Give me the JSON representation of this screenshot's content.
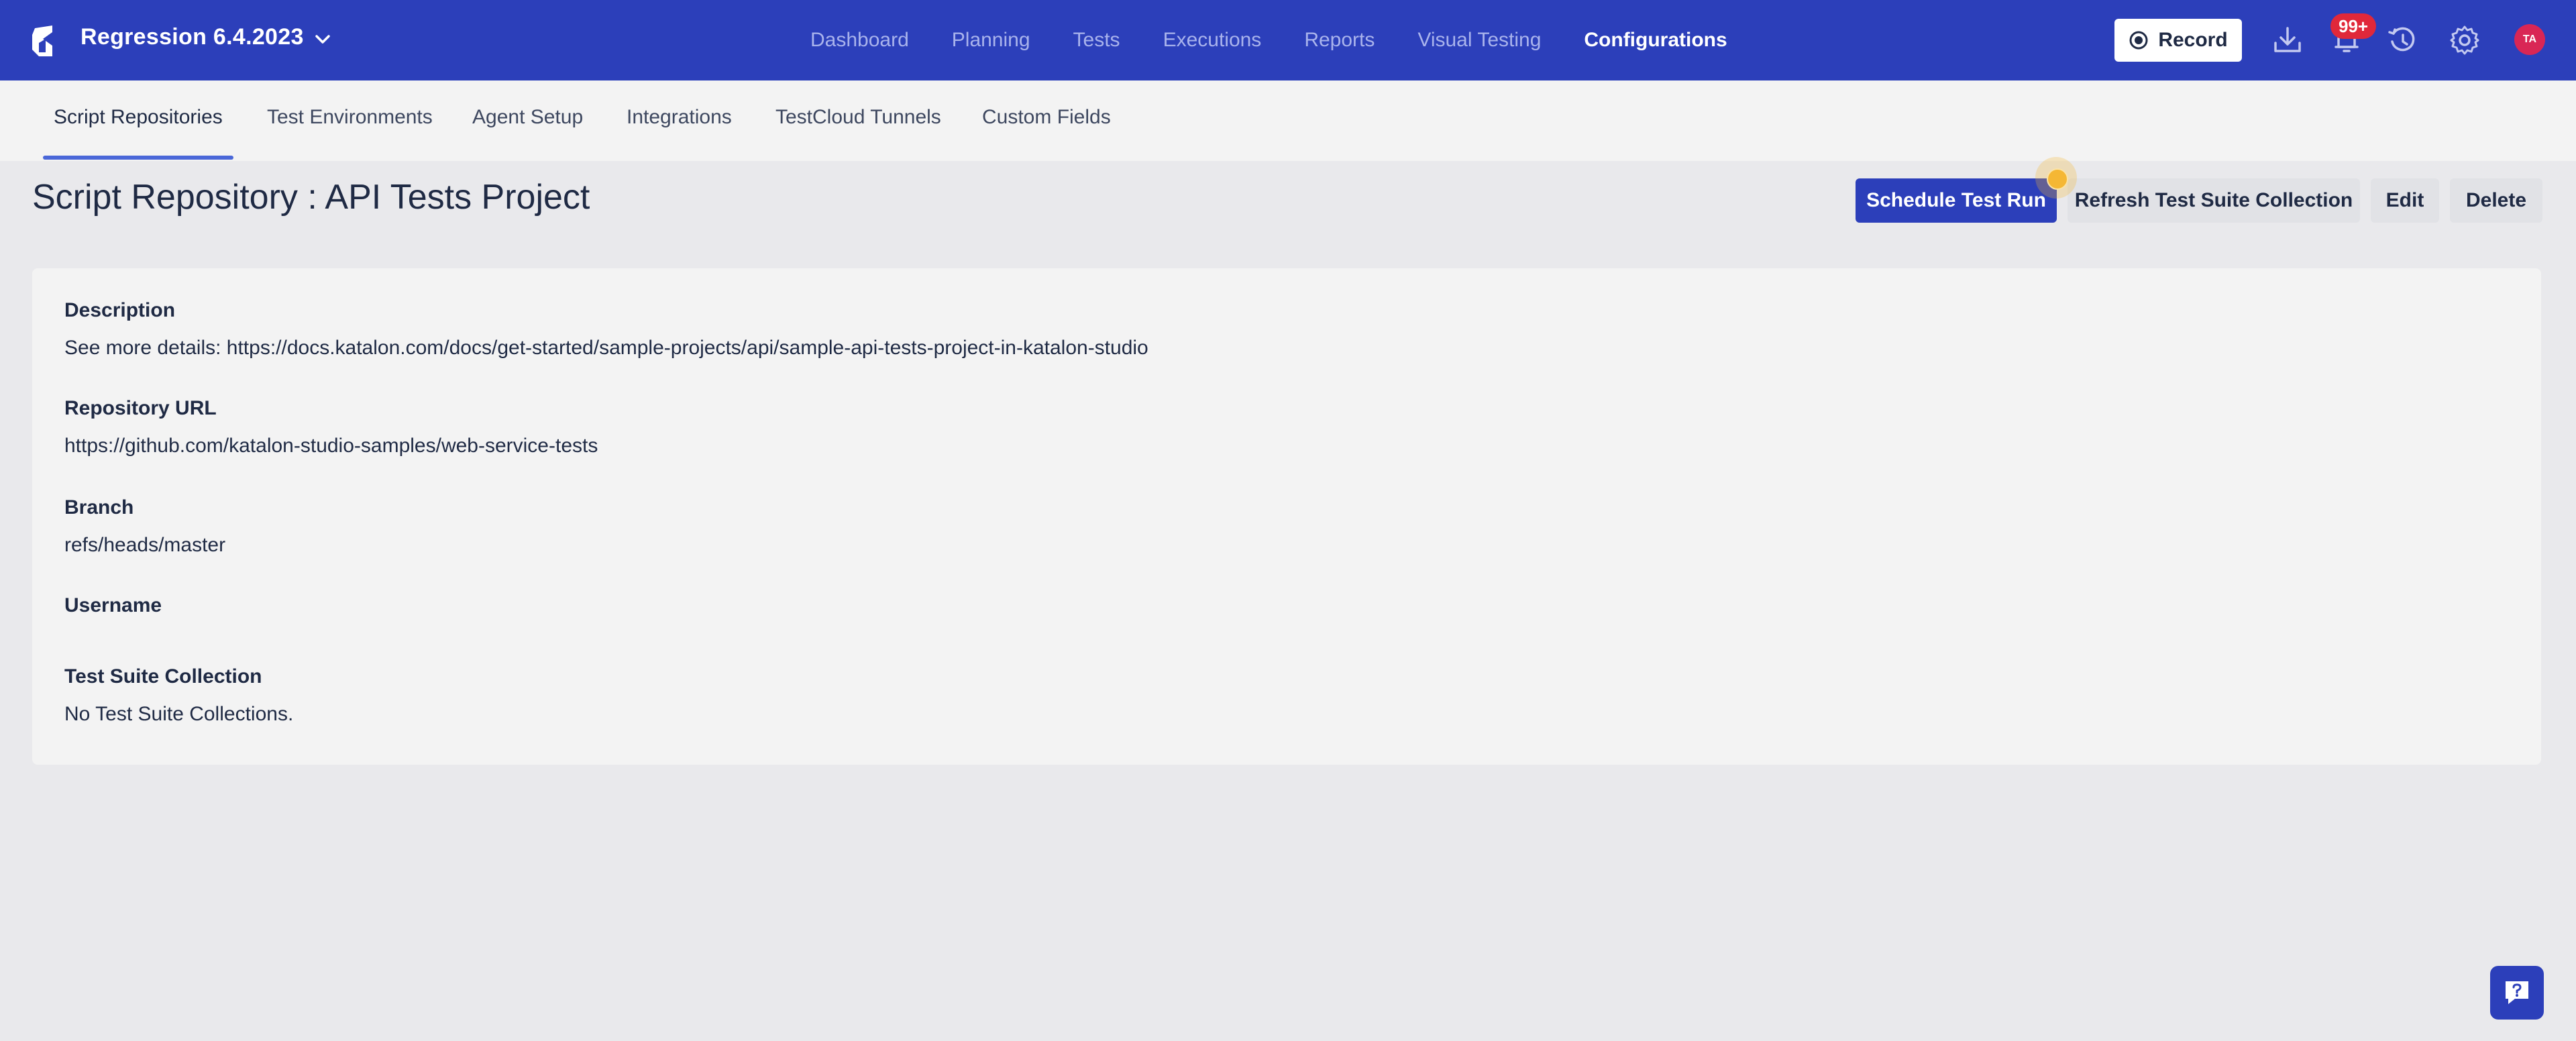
{
  "header": {
    "project_name": "Regression 6.4.2023",
    "nav": [
      {
        "label": "Dashboard"
      },
      {
        "label": "Planning"
      },
      {
        "label": "Tests"
      },
      {
        "label": "Executions"
      },
      {
        "label": "Reports"
      },
      {
        "label": "Visual Testing"
      },
      {
        "label": "Configurations",
        "active": true
      }
    ],
    "record_label": "Record",
    "notifications_badge": "99+",
    "avatar_initials": "TA",
    "colors": {
      "bar": "#2c3fba",
      "badge": "#e0283a",
      "avatar": "#d92655"
    }
  },
  "subnav": {
    "tabs": [
      {
        "label": "Script Repositories",
        "active": true
      },
      {
        "label": "Test Environments"
      },
      {
        "label": "Agent Setup"
      },
      {
        "label": "Integrations"
      },
      {
        "label": "TestCloud Tunnels"
      },
      {
        "label": "Custom Fields"
      }
    ]
  },
  "page": {
    "title": "Script Repository : API Tests Project",
    "actions": {
      "schedule": "Schedule Test Run",
      "refresh": "Refresh Test Suite Collection",
      "edit": "Edit",
      "delete": "Delete"
    }
  },
  "details": {
    "description_label": "Description",
    "description_value": "See more details: https://docs.katalon.com/docs/get-started/sample-projects/api/sample-api-tests-project-in-katalon-studio",
    "repo_url_label": "Repository URL",
    "repo_url_value": "https://github.com/katalon-studio-samples/web-service-tests",
    "branch_label": "Branch",
    "branch_value": "refs/heads/master",
    "username_label": "Username",
    "username_value": "",
    "tsc_label": "Test Suite Collection",
    "tsc_value": "No Test Suite Collections."
  },
  "icons": {
    "logo": "katalon-logo-icon",
    "project_dropdown": "chevron-down-icon",
    "record": "record-icon",
    "download": "download-icon",
    "notifications": "bell-icon",
    "history": "history-icon",
    "settings": "gear-icon",
    "help": "help-chat-icon"
  }
}
